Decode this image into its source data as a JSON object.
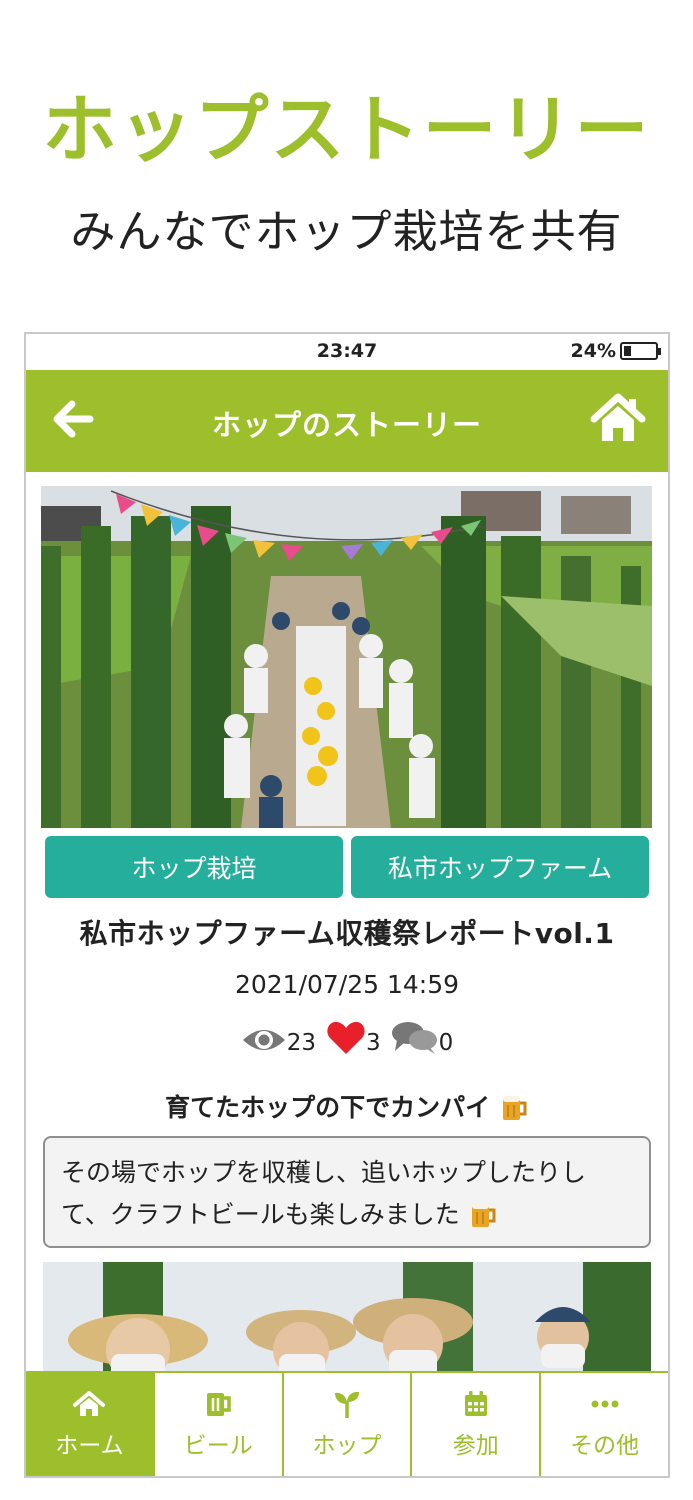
{
  "promo": {
    "title": "ホップストーリー",
    "subtitle": "みんなでホップ栽培を共有"
  },
  "status_bar": {
    "time": "23:47",
    "battery": "24%"
  },
  "app_bar": {
    "title": "ホップのストーリー",
    "back_icon": "arrow-left-icon",
    "home_icon": "home-icon"
  },
  "post": {
    "tags": [
      "ホップ栽培",
      "私市ホップファーム"
    ],
    "title": "私市ホップファーム収穫祭レポートvol.1",
    "date": "2021/07/25 14:59",
    "stats": {
      "views": "23",
      "likes": "3",
      "comments": "0"
    },
    "heading": "育てたホップの下でカンパイ",
    "body_line1": "その場でホップを収穫し、追いホップしたりし",
    "body_line2": "て、クラフトビールも楽しみました"
  },
  "tab_bar": {
    "items": [
      {
        "label": "ホーム",
        "icon": "home-icon",
        "active": true
      },
      {
        "label": "ビール",
        "icon": "beer-mug-icon",
        "active": false
      },
      {
        "label": "ホップ",
        "icon": "sprout-icon",
        "active": false
      },
      {
        "label": "参加",
        "icon": "calendar-icon",
        "active": false
      },
      {
        "label": "その他",
        "icon": "more-icon",
        "active": false
      }
    ]
  },
  "colors": {
    "brand_green": "#9cbf2b",
    "tag_teal": "#26ae9c",
    "like_red": "#e8202a"
  }
}
